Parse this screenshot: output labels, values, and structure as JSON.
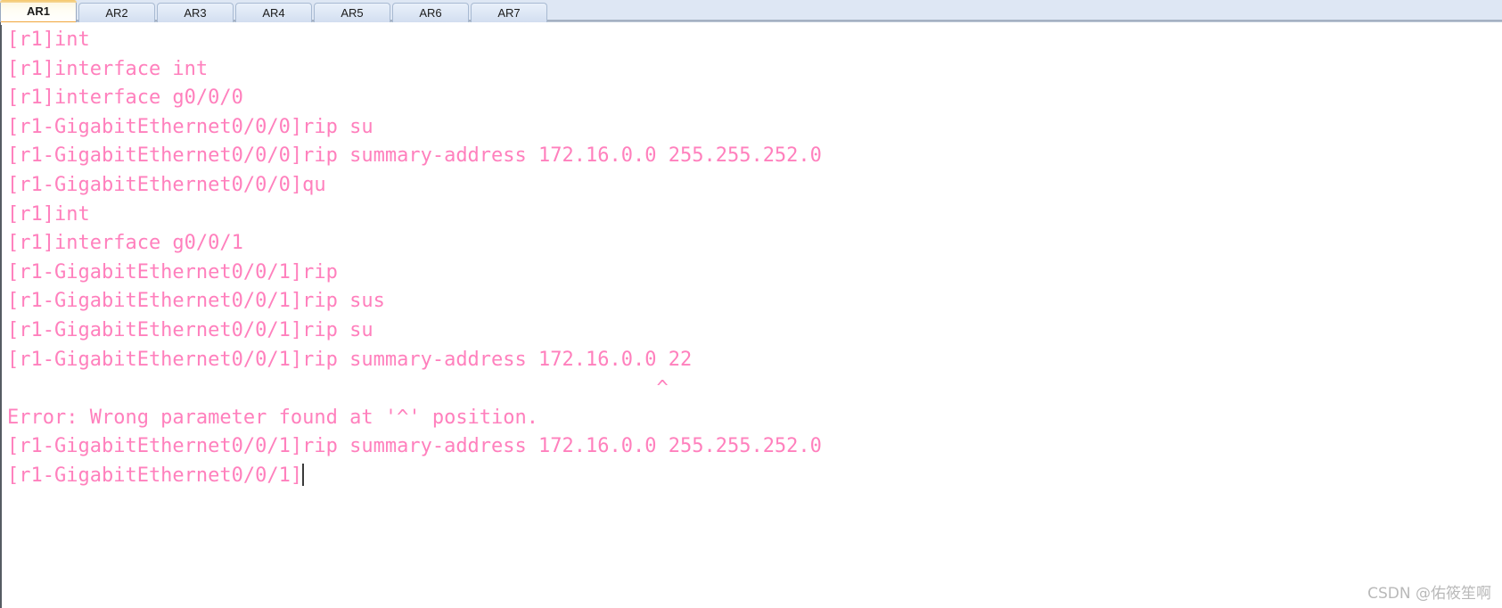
{
  "window": {
    "title": "AR1",
    "text_color": "#ff80bd",
    "background_color": "#ffffff",
    "tabstrip_color": "#dee7f4"
  },
  "tabs": [
    {
      "label": "AR1",
      "active": true
    },
    {
      "label": "AR2",
      "active": false
    },
    {
      "label": "AR3",
      "active": false
    },
    {
      "label": "AR4",
      "active": false
    },
    {
      "label": "AR5",
      "active": false
    },
    {
      "label": "AR6",
      "active": false
    },
    {
      "label": "AR7",
      "active": false
    }
  ],
  "console": {
    "lines": [
      "[r1]int",
      "[r1]interface int",
      "[r1]interface g0/0/0",
      "[r1-GigabitEthernet0/0/0]rip su",
      "[r1-GigabitEthernet0/0/0]rip summary-address 172.16.0.0 255.255.252.0",
      "[r1-GigabitEthernet0/0/0]qu",
      "[r1]int",
      "[r1]interface g0/0/1",
      "[r1-GigabitEthernet0/0/1]rip",
      "[r1-GigabitEthernet0/0/1]rip sus",
      "[r1-GigabitEthernet0/0/1]rip su",
      "[r1-GigabitEthernet0/0/1]rip summary-address 172.16.0.0 22",
      "                                                       ^",
      "Error: Wrong parameter found at '^' position.",
      "[r1-GigabitEthernet0/0/1]rip summary-address 172.16.0.0 255.255.252.0"
    ],
    "prompt": "[r1-GigabitEthernet0/0/1]"
  },
  "watermark": {
    "text": "CSDN @佑筱笙啊"
  }
}
